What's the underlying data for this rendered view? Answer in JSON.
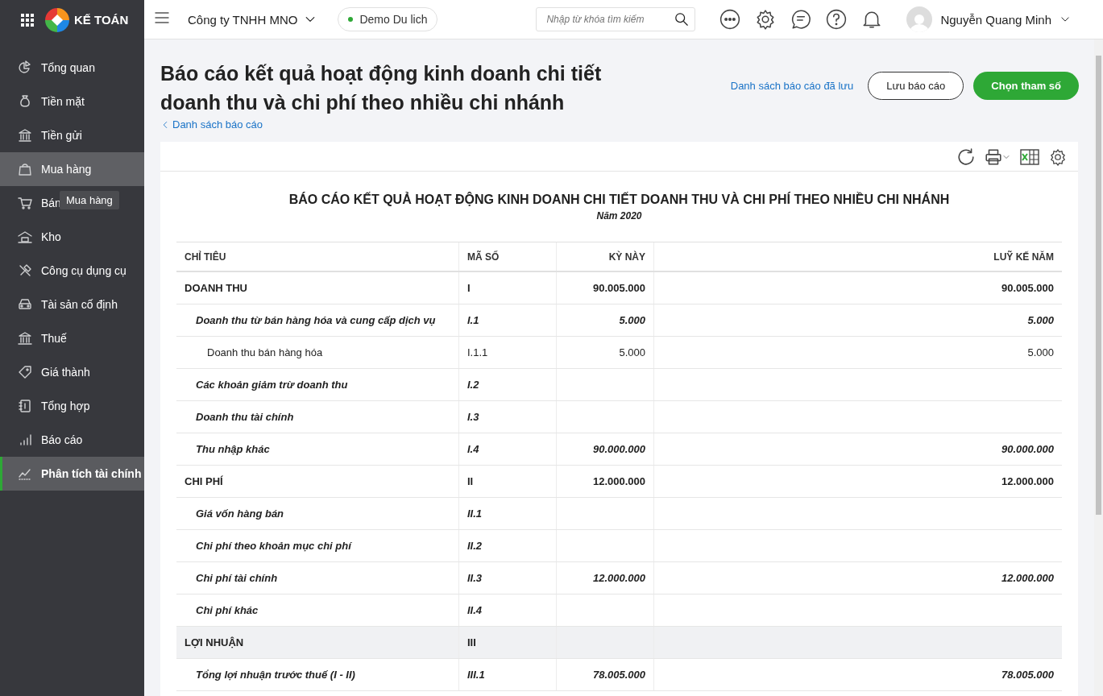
{
  "topbar": {
    "logo_text": "KẾ TOÁN",
    "company": "Công ty TNHH MNO",
    "demo_label": "Demo Du lich",
    "search": {
      "placeholder": "Nhập từ khóa tìm kiếm"
    },
    "user_name": "Nguyễn Quang Minh"
  },
  "sidebar": {
    "items": [
      {
        "label": "Tổng quan",
        "selected": false,
        "hovered": false
      },
      {
        "label": "Tiền mặt",
        "selected": false,
        "hovered": false
      },
      {
        "label": "Tiền gửi",
        "selected": false,
        "hovered": false
      },
      {
        "label": "Mua hàng",
        "selected": false,
        "hovered": true
      },
      {
        "label": "Bán",
        "selected": false,
        "hovered": false
      },
      {
        "label": "Kho",
        "selected": false,
        "hovered": false
      },
      {
        "label": "Công cụ dụng cụ",
        "selected": false,
        "hovered": false
      },
      {
        "label": "Tài sản cố định",
        "selected": false,
        "hovered": false
      },
      {
        "label": "Thuế",
        "selected": false,
        "hovered": false
      },
      {
        "label": "Giá thành",
        "selected": false,
        "hovered": false
      },
      {
        "label": "Tổng hợp",
        "selected": false,
        "hovered": false
      },
      {
        "label": "Báo cáo",
        "selected": false,
        "hovered": false
      },
      {
        "label": "Phân tích tài chính",
        "selected": true,
        "hovered": false
      }
    ],
    "tooltip": "Mua hàng"
  },
  "page": {
    "title": "Báo cáo kết quả hoạt động kinh doanh chi tiết doanh thu và chi phí theo nhiều chi nhánh",
    "back_link": "Danh sách báo cáo",
    "saved_link": "Danh sách báo cáo đã lưu",
    "save_button": "Lưu báo cáo",
    "params_button": "Chọn tham số"
  },
  "report": {
    "title": "BÁO CÁO KẾT QUẢ HOẠT ĐỘNG KINH DOANH CHI TIẾT DOANH THU VÀ CHI PHÍ THEO NHIỀU CHI NHÁNH",
    "subtitle": "Năm 2020",
    "columns": [
      "CHỈ TIÊU",
      "MÃ SỐ",
      "KỲ NÀY",
      "LUỸ KẾ NĂM"
    ],
    "rows": [
      {
        "name": "DOANH THU",
        "code": "I",
        "current": "90.005.000",
        "ytd": "90.005.000",
        "highlighted": false,
        "children": [
          {
            "name": "Doanh thu từ bán hàng hóa và cung cấp dịch vụ",
            "code": "I.1",
            "current": "5.000",
            "ytd": "5.000",
            "children": [
              {
                "name": "Doanh thu bán hàng hóa",
                "code": "I.1.1",
                "current": "5.000",
                "ytd": "5.000"
              }
            ]
          },
          {
            "name": "Các khoản giảm trừ doanh thu",
            "code": "I.2"
          },
          {
            "name": "Doanh thu tài chính",
            "code": "I.3"
          },
          {
            "name": "Thu nhập khác",
            "code": "I.4",
            "current": "90.000.000",
            "ytd": "90.000.000"
          }
        ]
      },
      {
        "name": "CHI PHÍ",
        "code": "II",
        "current": "12.000.000",
        "ytd": "12.000.000",
        "highlighted": false,
        "children": [
          {
            "name": "Giá vốn hàng bán",
            "code": "II.1"
          },
          {
            "name": "Chi phí theo khoản mục chi phí",
            "code": "II.2"
          },
          {
            "name": "Chi phí tài chính",
            "code": "II.3",
            "current": "12.000.000",
            "ytd": "12.000.000"
          },
          {
            "name": "Chi phí khác",
            "code": "II.4"
          }
        ]
      },
      {
        "name": "LỢI NHUẬN",
        "code": "III",
        "highlighted": true,
        "children": [
          {
            "name": "Tổng lợi nhuận trước thuế (I - II)",
            "code": "III.1",
            "current": "78.005.000",
            "ytd": "78.005.000"
          }
        ]
      }
    ]
  }
}
